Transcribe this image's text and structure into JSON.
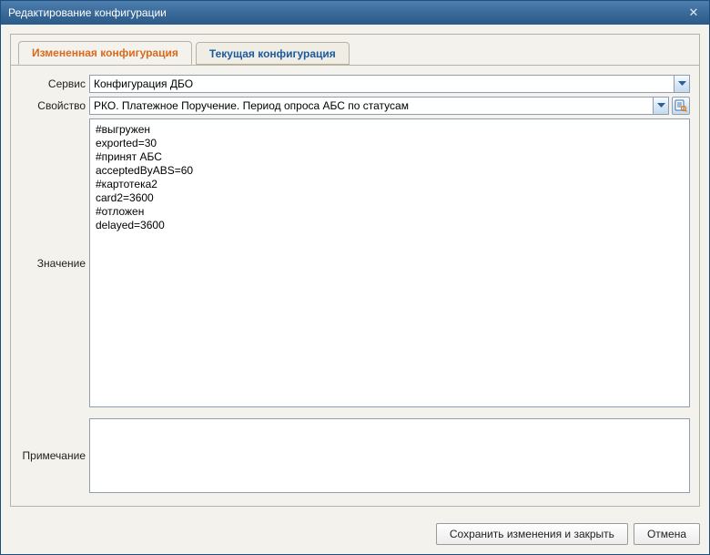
{
  "window": {
    "title": "Редактирование конфигурации"
  },
  "tabs": {
    "changed": "Измененная конфигурация",
    "current": "Текущая конфигурация"
  },
  "labels": {
    "service": "Сервис",
    "property": "Свойство",
    "value": "Значение",
    "note": "Примечание"
  },
  "fields": {
    "service": "Конфигурация ДБО",
    "property": "РКО. Платежное Поручение. Период опроса АБС по статусам",
    "value": "#выгружен\nexported=30\n#принят АБС\nacceptedByABS=60\n#картотека2\ncard2=3600\n#отложен\ndelayed=3600",
    "note": ""
  },
  "buttons": {
    "save": "Сохранить изменения и закрыть",
    "cancel": "Отмена"
  }
}
